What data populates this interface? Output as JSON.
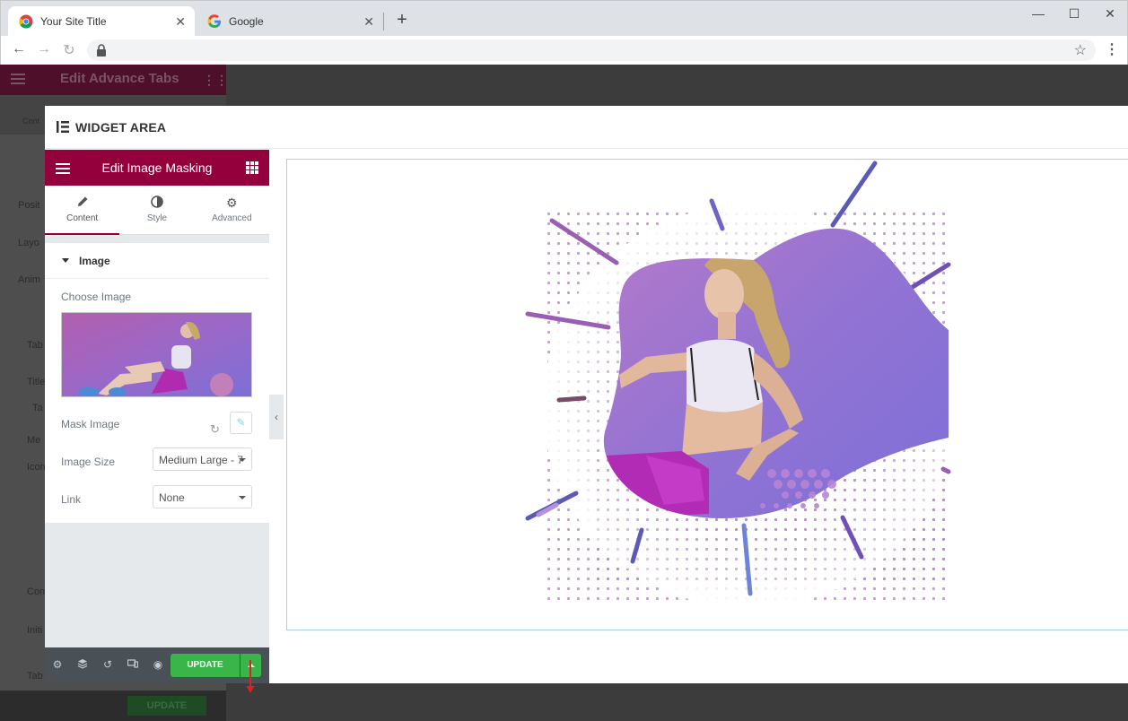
{
  "browser": {
    "tabs": [
      {
        "title": "Your Site Title",
        "active": true,
        "icon": "chrome-icon"
      },
      {
        "title": "Google",
        "active": false,
        "icon": "google-icon"
      }
    ],
    "new_tab": "+",
    "window_controls": {
      "minimize": "—",
      "maximize": "☐",
      "close": "✕"
    }
  },
  "background_editor": {
    "title": "Edit Advance Tabs",
    "labels": [
      "Posit",
      "Layo",
      "Anim",
      "Tab",
      "Title",
      "Ta",
      "Me",
      "Icon",
      "Con",
      "Initi",
      "Tab"
    ],
    "tab_short": "Cont",
    "update": "UPDATE"
  },
  "modal": {
    "title": "WIDGET AREA"
  },
  "panel": {
    "title": "Edit Image Masking",
    "tabs": [
      {
        "label": "Content",
        "icon": "pencil-icon",
        "active": true
      },
      {
        "label": "Style",
        "icon": "half-circle-icon",
        "active": false
      },
      {
        "label": "Advanced",
        "icon": "gear-icon",
        "active": false
      }
    ],
    "section": "Image",
    "controls": {
      "choose_image": "Choose Image",
      "mask_image": "Mask Image",
      "image_size_label": "Image Size",
      "image_size_value": "Medium Large - 7",
      "link_label": "Link",
      "link_value": "None"
    },
    "footer": {
      "update": "UPDATE"
    }
  },
  "colors": {
    "header": "#93003c",
    "update": "#39b54a",
    "footer": "#495157"
  }
}
